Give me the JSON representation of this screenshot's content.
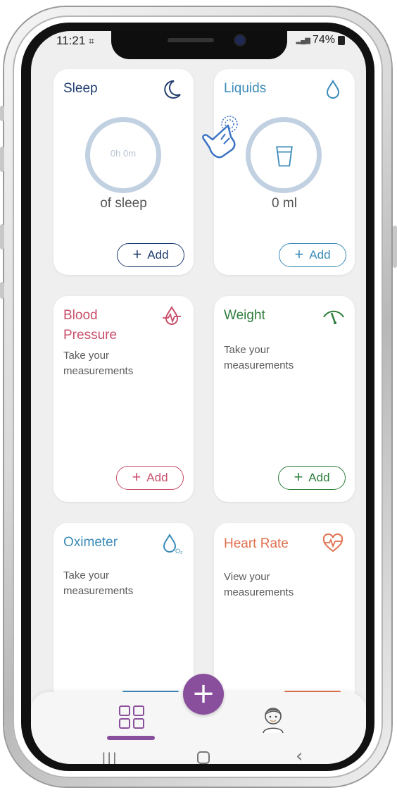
{
  "status_bar": {
    "time": "11:21",
    "signal": "▂▄▆",
    "battery": "74%"
  },
  "cards": {
    "sleep": {
      "title": "Sleep",
      "value": "0h 0m",
      "caption": "of sleep",
      "add_label": "Add",
      "color": "#1f3c6e"
    },
    "liquids": {
      "title": "Liquids",
      "caption": "0 ml",
      "add_label": "Add",
      "color": "#3b8bb8"
    },
    "blood_pressure": {
      "title_line1": "Blood",
      "title_line2": "Pressure",
      "subtitle_line1": "Take your",
      "subtitle_line2": "measurements",
      "add_label": "Add",
      "color": "#c94f6a"
    },
    "weight": {
      "title": "Weight",
      "subtitle_line1": "Take your",
      "subtitle_line2": "measurements",
      "add_label": "Add",
      "color": "#2e7d3c"
    },
    "oximeter": {
      "title": "Oximeter",
      "subtitle_line1": "Take your",
      "subtitle_line2": "measurements",
      "color": "#3b8bb8"
    },
    "heart_rate": {
      "title": "Heart Rate",
      "subtitle_line1": "View your",
      "subtitle_line2": "measurements",
      "color": "#e0714f"
    }
  },
  "fab": {
    "label": "+"
  },
  "icons": {
    "sleep": "moon-icon",
    "liquids": "water-drop-icon",
    "blood_pressure": "blood-drop-pulse-icon",
    "weight": "scale-gauge-icon",
    "oximeter": "oxygen-drop-icon",
    "heart_rate": "heart-pulse-icon",
    "tap_hint": "tap-hand-icon",
    "nav_dashboard": "dashboard-grid-icon",
    "nav_profile": "avatar-icon"
  },
  "accent_color": "#8a4f9c"
}
